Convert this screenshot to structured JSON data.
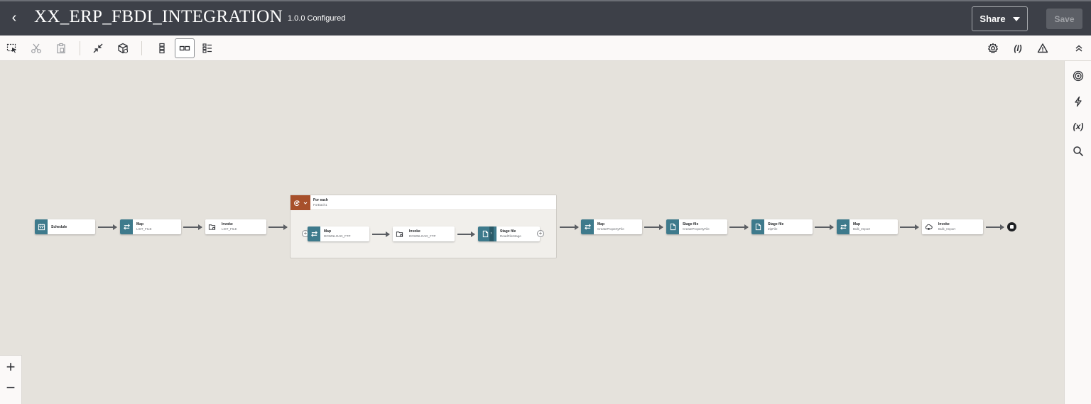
{
  "header": {
    "back_glyph": "‹",
    "title": "XX_ERP_FBDI_INTEGRATION",
    "version": "1.0.0 Configured",
    "share_label": "Share",
    "save_label": "Save"
  },
  "toolbar": {
    "left_icons": [
      "select-icon",
      "cut-icon",
      "paste-icon",
      "collapse-icon",
      "package-icon",
      "vertical-layout-icon",
      "horizontal-layout-icon",
      "pseudo-layout-icon"
    ],
    "right_icons": [
      "gear-icon",
      "tracking-icon",
      "warning-icon",
      "chevron-up-icon"
    ],
    "tracking_text": "(I)"
  },
  "rail": {
    "icons": [
      "target-icon",
      "lightning-icon",
      "variable-icon",
      "search-icon"
    ],
    "variable_text": "(x)"
  },
  "zoom": {
    "in": "+",
    "out": "−"
  },
  "colors": {
    "header": "#3d4048",
    "node_icon": "#3e7a8c",
    "foreach_icon": "#a7502b",
    "canvas": "#e5e2dc"
  },
  "flow": {
    "schedule": {
      "label": "Schedule"
    },
    "map1": {
      "label": "Map",
      "sub": "LIST_FILE"
    },
    "invoke1": {
      "label": "Invoke",
      "sub": "LIST_FILE"
    },
    "foreach": {
      "label": "For each",
      "sub": "ForEach1"
    },
    "map2": {
      "label": "Map",
      "sub": "DOWNLOAD_FTP"
    },
    "invoke2": {
      "label": "Invoke",
      "sub": "DOWNLOAD_FTP"
    },
    "stage1": {
      "label": "Stage file",
      "sub": "ReadFileStage"
    },
    "map3": {
      "label": "Map",
      "sub": "CreatePropertyFile"
    },
    "stage2": {
      "label": "Stage file",
      "sub": "CreatePropertyFile"
    },
    "stage3": {
      "label": "Stage file",
      "sub": "ZipFile"
    },
    "map4": {
      "label": "Map",
      "sub": "Bulk_Import"
    },
    "invoke3": {
      "label": "Invoke",
      "sub": "Bulk_Import"
    }
  }
}
